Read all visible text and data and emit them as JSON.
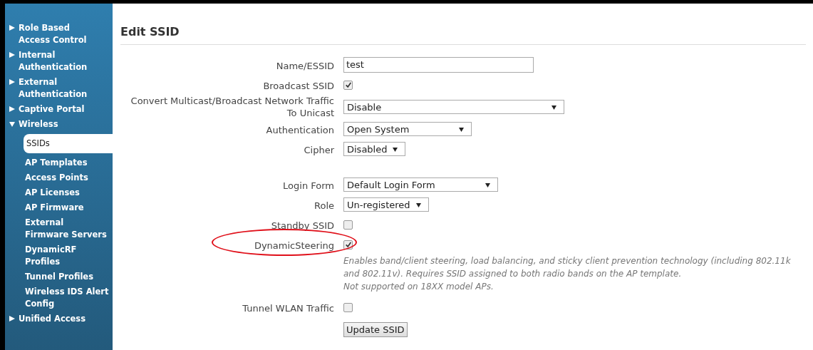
{
  "sidebar": {
    "items": [
      {
        "label": "Role Based Access Control",
        "expanded": false
      },
      {
        "label": "Internal Authentication",
        "expanded": false
      },
      {
        "label": "External Authentication",
        "expanded": false
      },
      {
        "label": "Captive Portal",
        "expanded": false
      },
      {
        "label": "Wireless",
        "expanded": true,
        "children": [
          {
            "label": "SSIDs",
            "selected": true
          },
          {
            "label": "AP Templates",
            "selected": false
          },
          {
            "label": "Access Points",
            "selected": false
          },
          {
            "label": "AP Licenses",
            "selected": false
          },
          {
            "label": "AP Firmware",
            "selected": false
          },
          {
            "label": "External Firmware Servers",
            "selected": false
          },
          {
            "label": "DynamicRF Profiles",
            "selected": false
          },
          {
            "label": "Tunnel Profiles",
            "selected": false
          },
          {
            "label": "Wireless IDS Alert Config",
            "selected": false
          }
        ]
      },
      {
        "label": "Unified Access",
        "expanded": false
      }
    ]
  },
  "page_title": "Edit SSID",
  "form_groups": [
    [
      {
        "kind": "text",
        "label": "Name/ESSID",
        "value": "test"
      },
      {
        "kind": "checkbox",
        "label": "Broadcast SSID",
        "checked": true
      },
      {
        "kind": "select",
        "label": "Convert Multicast/Broadcast Network Traffic To Unicast",
        "value": "Disable",
        "wide": true,
        "compact": false
      },
      {
        "kind": "select",
        "label": "Authentication",
        "value": "Open System",
        "wide": false,
        "compact": false
      },
      {
        "kind": "select",
        "label": "Cipher",
        "value": "Disabled",
        "wide": false,
        "compact": true
      }
    ],
    [
      {
        "kind": "select",
        "label": "Login Form",
        "value": "Default Login Form",
        "wide": false,
        "compact": false
      },
      {
        "kind": "select",
        "label": "Role",
        "value": "Un-registered",
        "wide": false,
        "compact": true
      },
      {
        "kind": "checkbox",
        "label": "Standby SSID",
        "checked": false
      },
      {
        "kind": "checkbox",
        "label": "DynamicSteering",
        "checked": true,
        "highlighted": true,
        "note": [
          "Enables band/client steering, load balancing, and sticky client prevention technology (including 802.11k and 802.11v). Requires SSID assigned to both radio bands on the AP template.",
          "Not supported on 18XX model APs."
        ]
      },
      {
        "kind": "checkbox",
        "label": "Tunnel WLAN Traffic",
        "checked": false
      },
      {
        "kind": "button",
        "label": "Update SSID"
      }
    ]
  ]
}
